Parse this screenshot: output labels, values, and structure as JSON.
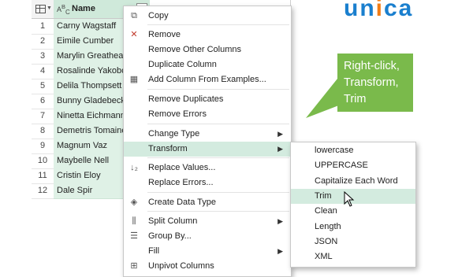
{
  "grid": {
    "column_header": "Name",
    "type_icon_text": "ABC",
    "rows": [
      {
        "index": "1",
        "name": "Carny Wagstaff"
      },
      {
        "index": "2",
        "name": "Eimile Cumber"
      },
      {
        "index": "3",
        "name": "Marylin Greathead"
      },
      {
        "index": "4",
        "name": "Rosalinde Yakobovitz"
      },
      {
        "index": "5",
        "name": "Delila Thompsett"
      },
      {
        "index": "6",
        "name": "Bunny Gladebeck"
      },
      {
        "index": "7",
        "name": "Ninetta Eichmann"
      },
      {
        "index": "8",
        "name": "Demetris Tomaino"
      },
      {
        "index": "9",
        "name": "Magnum Vaz"
      },
      {
        "index": "10",
        "name": "Maybelle Nell"
      },
      {
        "index": "11",
        "name": "Cristin Eloy"
      },
      {
        "index": "12",
        "name": "Dale Spir"
      }
    ]
  },
  "context_menu": {
    "items": [
      {
        "label": "Copy",
        "icon": "copy-icon"
      },
      {
        "label": "Remove",
        "icon": "remove-x-icon"
      },
      {
        "label": "Remove Other Columns"
      },
      {
        "label": "Duplicate Column"
      },
      {
        "label": "Add Column From Examples...",
        "icon": "add-column-icon"
      },
      {
        "label": "Remove Duplicates"
      },
      {
        "label": "Remove Errors"
      },
      {
        "label": "Change Type",
        "submenu": true
      },
      {
        "label": "Transform",
        "submenu": true,
        "highlighted": true
      },
      {
        "label": "Replace Values...",
        "icon": "replace-values-icon"
      },
      {
        "label": "Replace Errors..."
      },
      {
        "label": "Create Data Type",
        "icon": "data-type-icon"
      },
      {
        "label": "Split Column",
        "icon": "split-column-icon",
        "submenu": true
      },
      {
        "label": "Group By...",
        "icon": "group-by-icon"
      },
      {
        "label": "Fill",
        "submenu": true
      },
      {
        "label": "Unpivot Columns",
        "icon": "unpivot-icon"
      }
    ]
  },
  "transform_submenu": {
    "items": [
      {
        "label": "lowercase"
      },
      {
        "label": "UPPERCASE"
      },
      {
        "label": "Capitalize Each Word"
      },
      {
        "label": "Trim",
        "highlighted": true
      },
      {
        "label": "Clean"
      },
      {
        "label": "Length"
      },
      {
        "label": "JSON"
      },
      {
        "label": "XML"
      }
    ]
  },
  "callout": {
    "line1": "Right-click,",
    "line2": "Transform,",
    "line3": "Trim",
    "color": "#7aba4b"
  },
  "logo": {
    "text_before_dot": "un",
    "dot_letter": "i",
    "text_after_dot": "ca",
    "color": "#1a7fce",
    "accent": "#f27d16"
  },
  "colors": {
    "highlight": "#d3ebdf",
    "column_fill": "#dff1e6"
  }
}
